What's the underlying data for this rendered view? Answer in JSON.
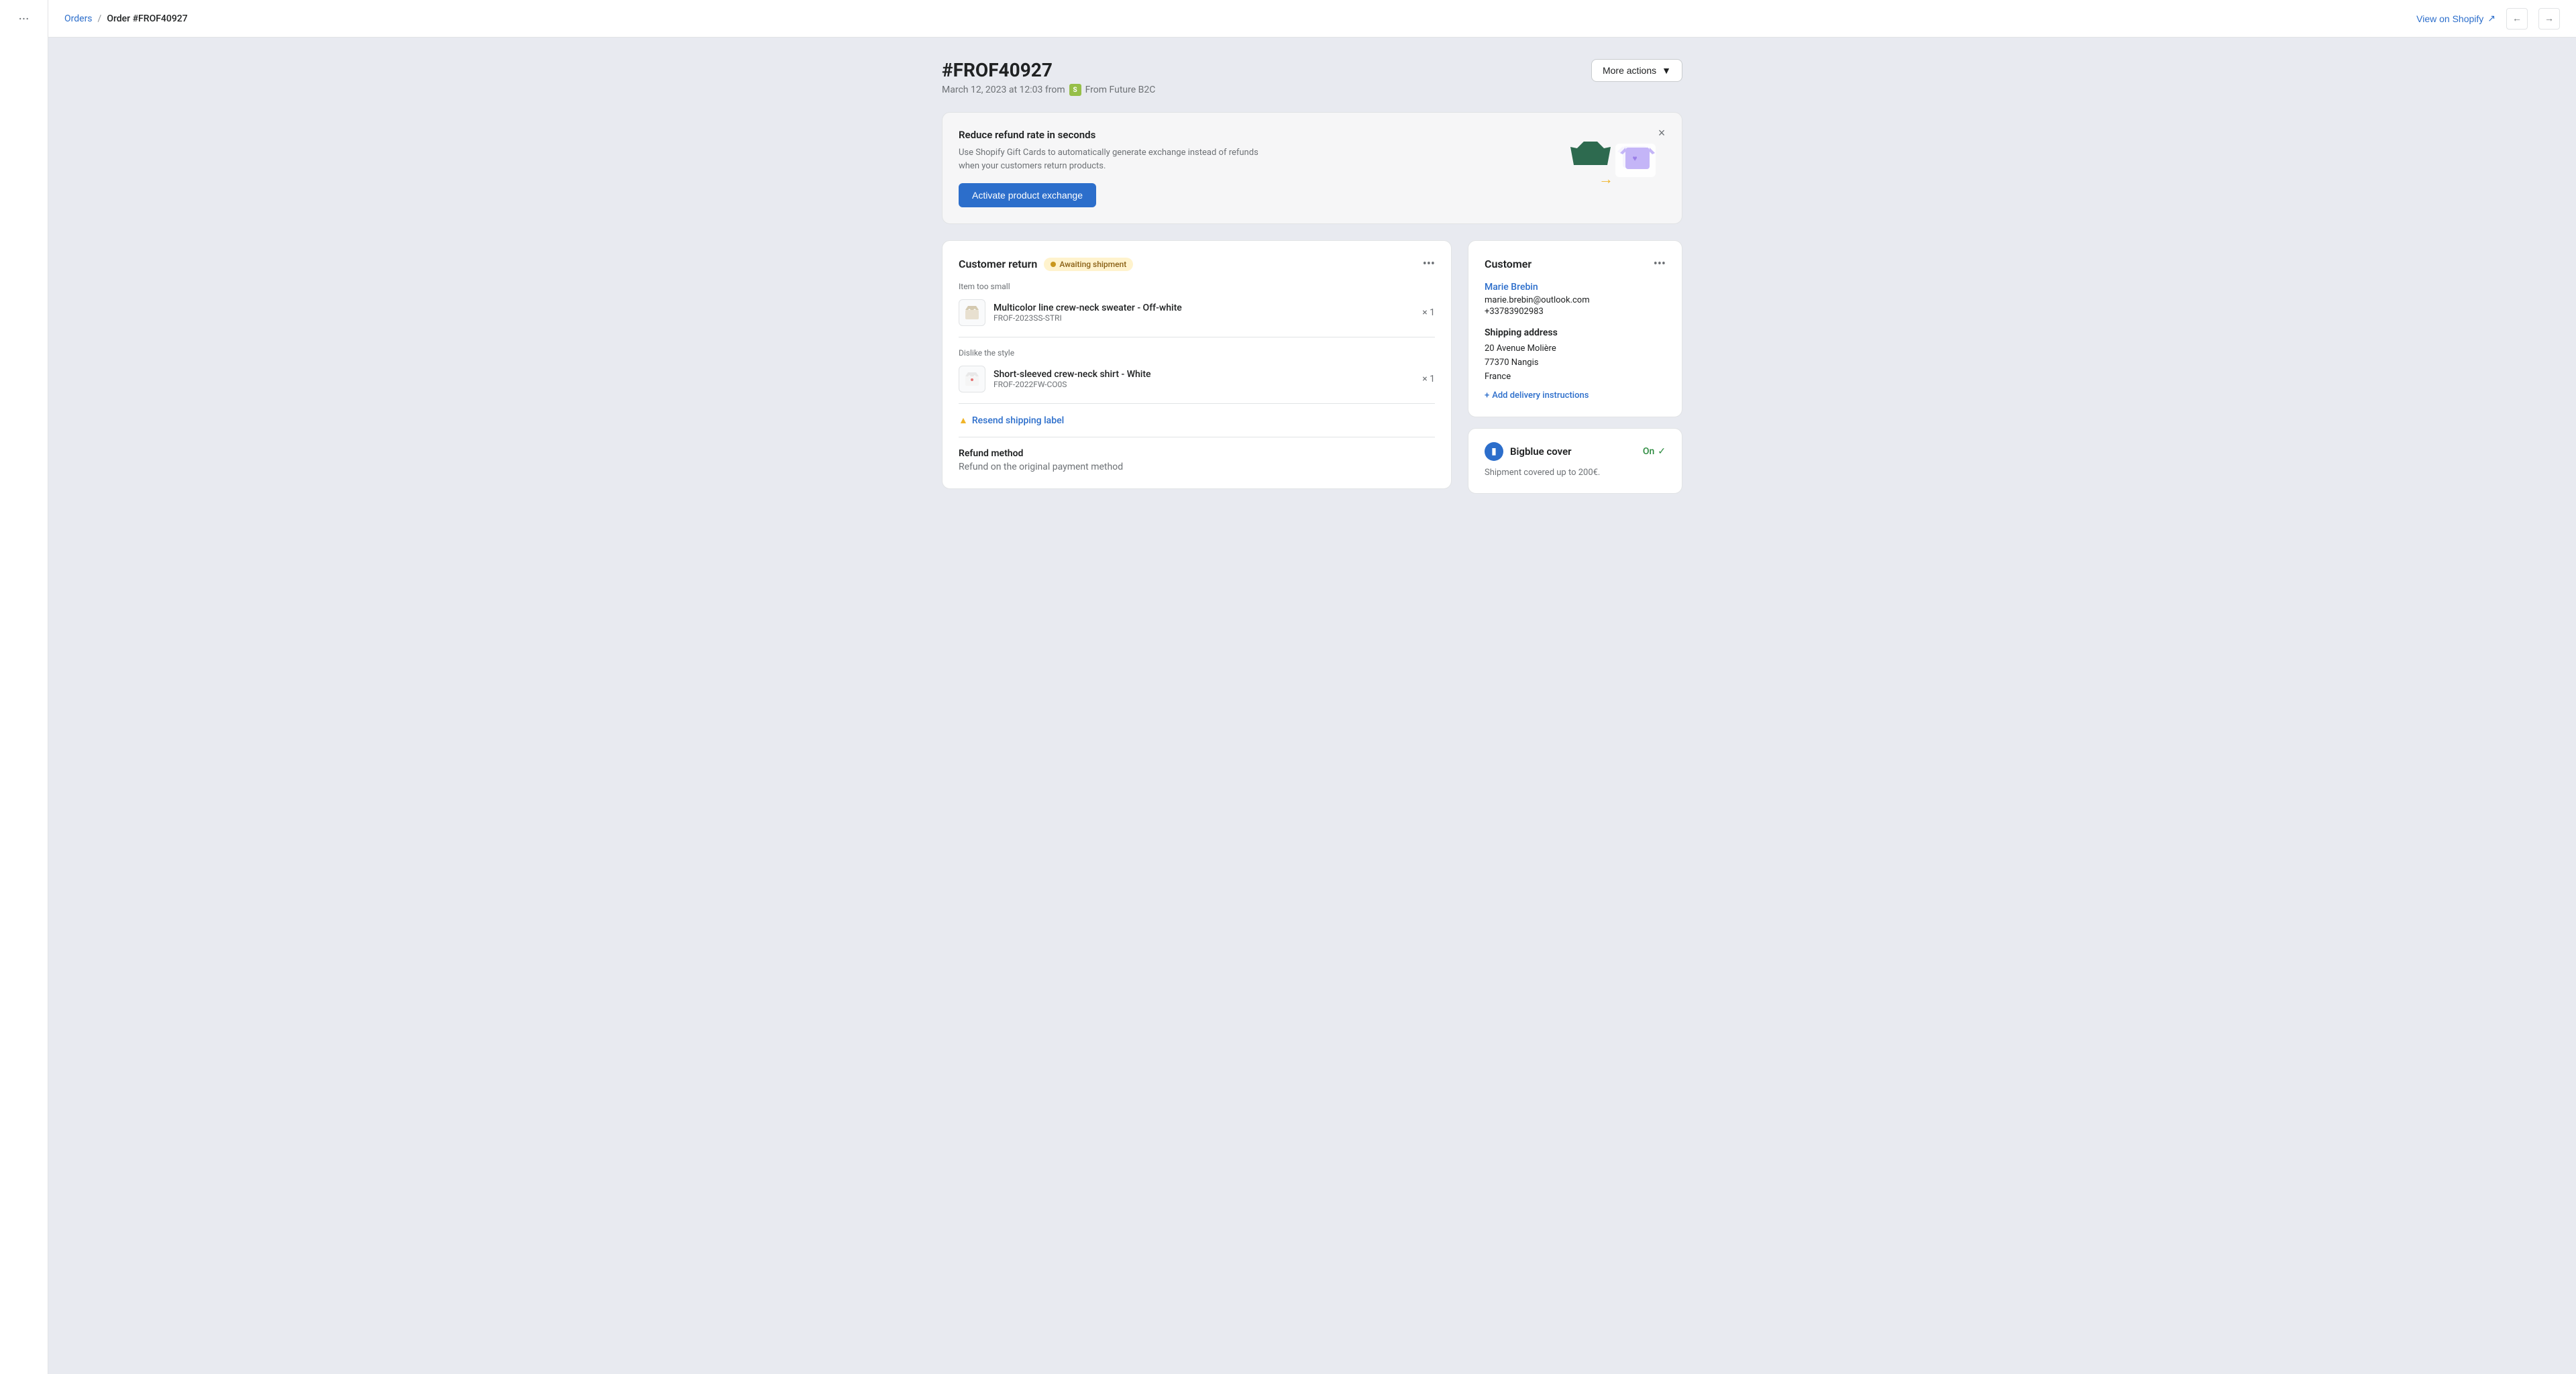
{
  "sidebar": {
    "dots_label": "···"
  },
  "topbar": {
    "breadcrumb_orders": "Orders",
    "breadcrumb_separator": "/",
    "breadcrumb_current": "Order #FROF40927",
    "view_shopify_label": "View on Shopify"
  },
  "page": {
    "order_title": "#FROF40927",
    "order_date": "March 12, 2023 at 12:03 from",
    "order_source": "From Future B2C",
    "more_actions_label": "More actions"
  },
  "promo": {
    "title": "Reduce refund rate in seconds",
    "description": "Use Shopify Gift Cards to automatically generate exchange instead of refunds when your customers return products.",
    "button_label": "Activate product exchange"
  },
  "customer_return": {
    "title": "Customer return",
    "status": "Awaiting shipment",
    "reason1": "Item too small",
    "product1_name": "Multicolor line crew-neck sweater - Off-white",
    "product1_sku": "FROF-2023SS-STRI",
    "product1_qty": "× 1",
    "reason2": "Dislike the style",
    "product2_name": "Short-sleeved crew-neck shirt - White",
    "product2_sku": "FROF-2022FW-CO0S",
    "product2_qty": "× 1",
    "resend_label": "Resend shipping label",
    "refund_title": "Refund method",
    "refund_desc": "Refund on the original payment method"
  },
  "customer": {
    "title": "Customer",
    "name": "Marie Brebin",
    "email": "marie.brebin@outlook.com",
    "phone": "+33783902983",
    "shipping_title": "Shipping address",
    "address_line1": "20 Avenue Molière",
    "address_line2": "77370 Nangis",
    "address_line3": "France",
    "add_delivery_label": "Add delivery instructions"
  },
  "bigblue": {
    "title": "Bigblue cover",
    "status": "On",
    "description": "Shipment covered up to 200€."
  }
}
